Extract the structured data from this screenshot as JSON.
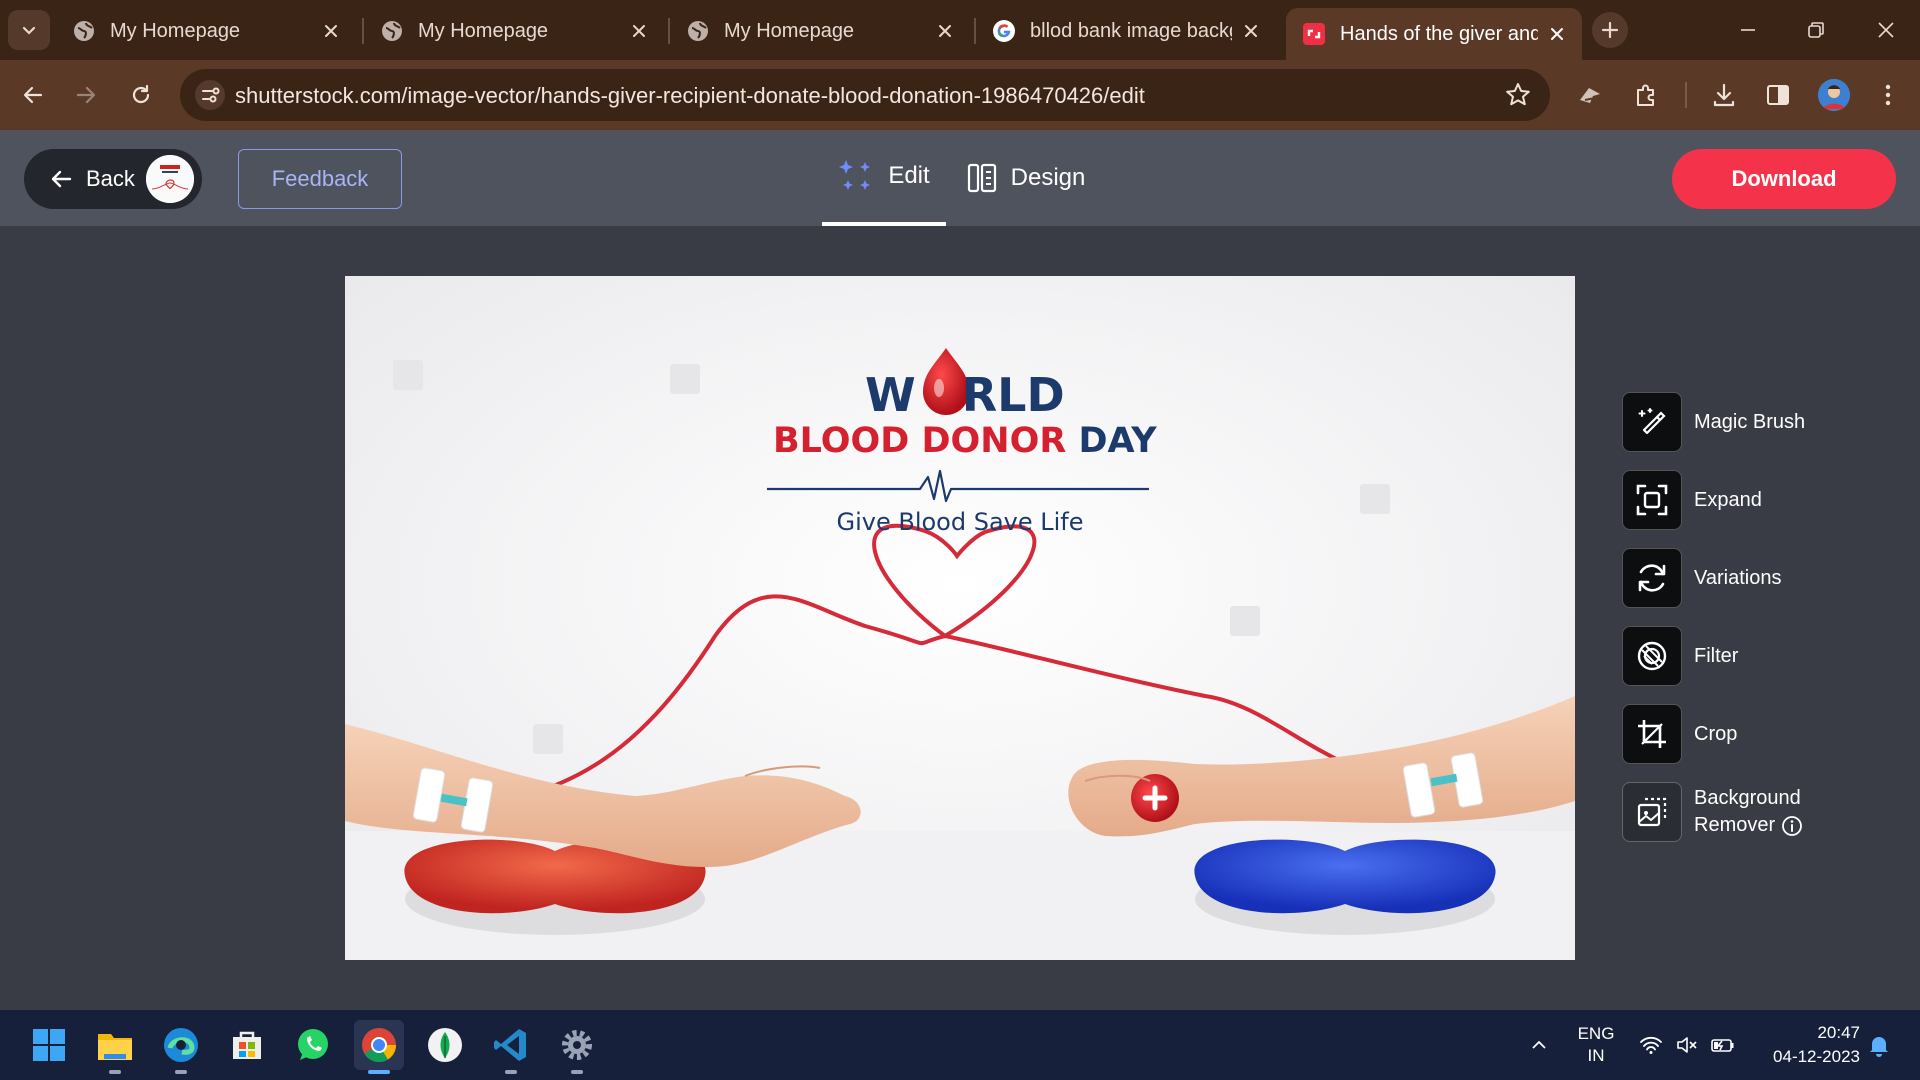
{
  "browser": {
    "tabs": [
      {
        "title": "My Homepage",
        "favicon": "globe-icon"
      },
      {
        "title": "My Homepage",
        "favicon": "globe-icon"
      },
      {
        "title": "My Homepage",
        "favicon": "globe-icon"
      },
      {
        "title": "bllod bank image backgr",
        "favicon": "google-icon"
      },
      {
        "title": "Hands of the giver and th",
        "favicon": "shutterstock-icon"
      }
    ],
    "url": "shutterstock.com/image-vector/hands-giver-recipient-donate-blood-donation-1986470426/edit"
  },
  "editor": {
    "back_label": "Back",
    "feedback_label": "Feedback",
    "tabs": {
      "edit": "Edit",
      "design": "Design"
    },
    "download_label": "Download",
    "tools": [
      {
        "label": "Magic Brush",
        "icon": "magic-brush-icon"
      },
      {
        "label": "Expand",
        "icon": "expand-icon"
      },
      {
        "label": "Variations",
        "icon": "variations-icon"
      },
      {
        "label": "Filter",
        "icon": "filter-icon"
      },
      {
        "label": "Crop",
        "icon": "crop-icon"
      },
      {
        "label": "Background Remover",
        "icon": "background-remover-icon",
        "line1": "Background",
        "line2": "Remover"
      }
    ]
  },
  "poster": {
    "title_world_w": "W",
    "title_world_rest": "RLD",
    "title_blood_donor": "BLOOD DONOR",
    "title_day": "DAY",
    "tagline": "Give Blood Save Life",
    "colors": {
      "red": "#d5202f",
      "navy": "#1c3a6b"
    }
  },
  "taskbar": {
    "apps": [
      "start-icon",
      "file-explorer-icon",
      "edge-icon",
      "store-icon",
      "whatsapp-icon",
      "chrome-icon",
      "mongodb-compass-icon",
      "vscode-icon",
      "settings-icon"
    ],
    "language": "ENG",
    "region": "IN",
    "time": "20:47",
    "date": "04-12-2023"
  }
}
